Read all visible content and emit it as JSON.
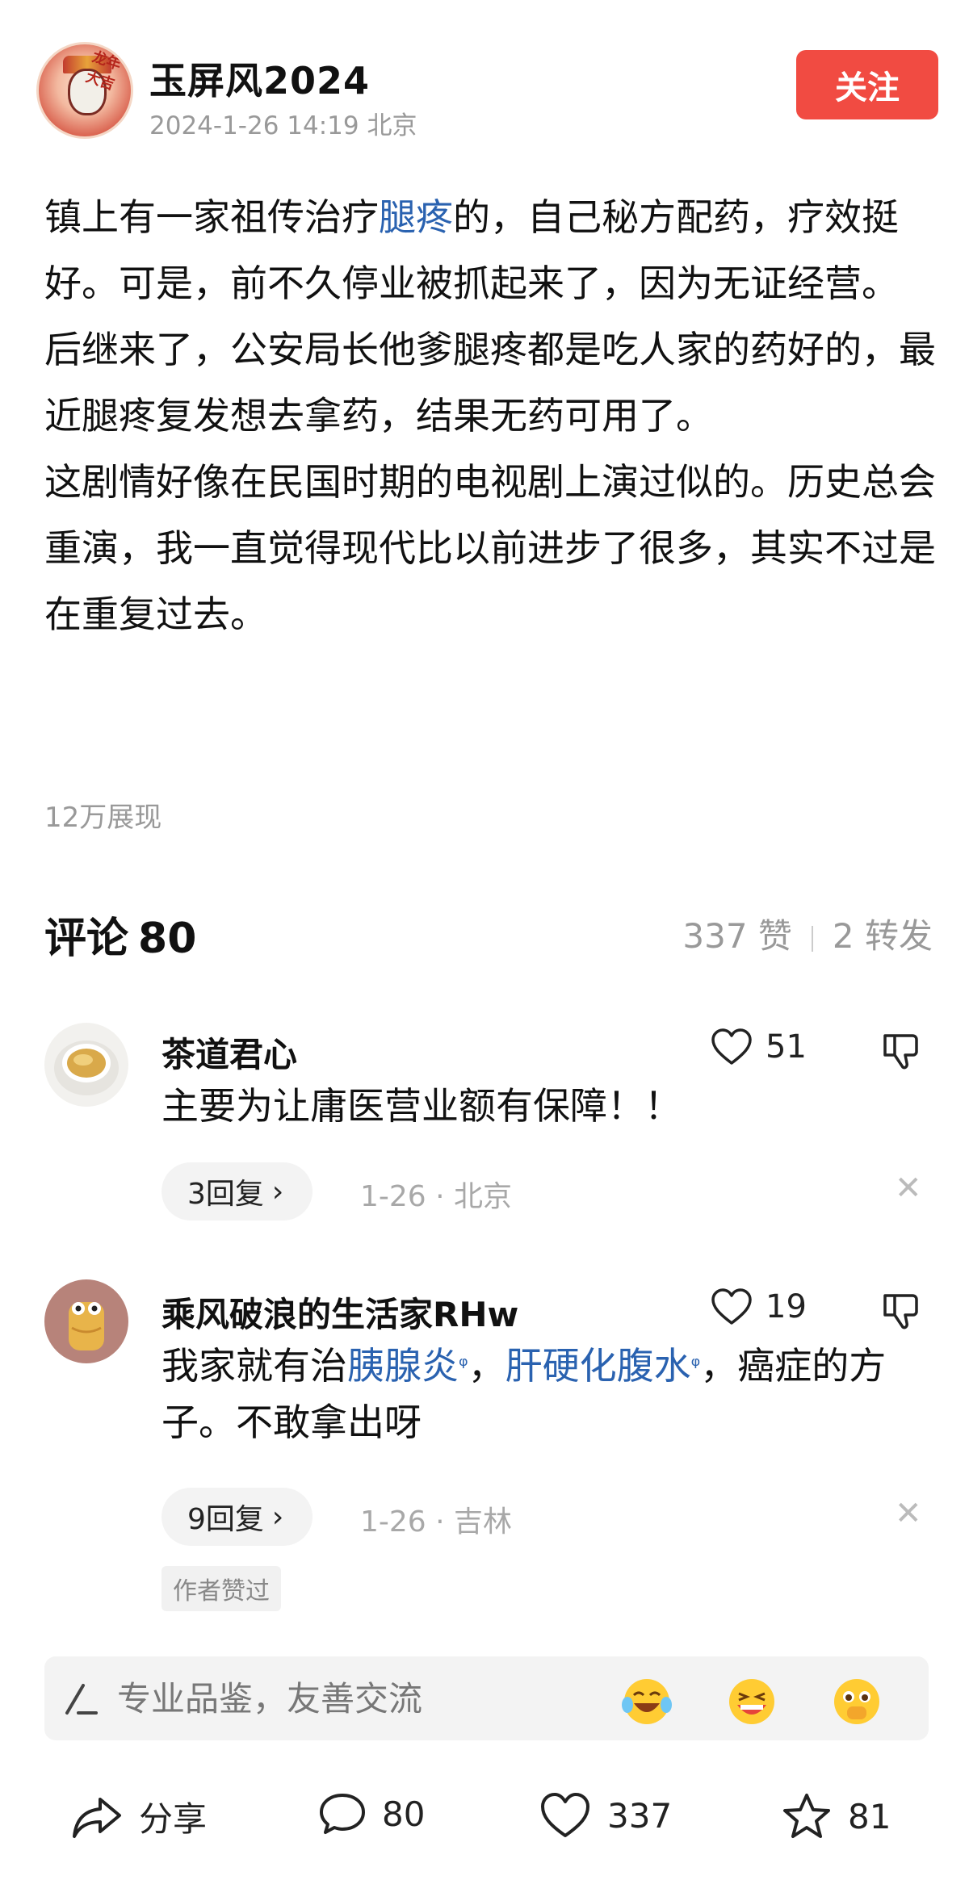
{
  "header": {
    "username": "玉屏风2024",
    "meta": "2024-1-26 14:19 北京",
    "follow_label": "关注",
    "avatar_text": "龙年大吉"
  },
  "post": {
    "para1_pre": "镇上有一家祖传治疗",
    "para1_link": "腿疼",
    "para1_post": "的，自己秘方配药，疗效挺好。可是，前不久停业被抓起来了，因为无证经营。",
    "para2": "后继来了，公安局长他爹腿疼都是吃人家的药好的，最近腿疼复发想去拿药，结果无药可用了。",
    "para3": "这剧情好像在民国时期的电视剧上演过似的。历史总会重演，我一直觉得现代比以前进步了很多，其实不过是在重复过去。",
    "views": "12万展现"
  },
  "comments_header": {
    "title": "评论",
    "count": "80",
    "likes": "337 赞",
    "reposts": "2 转发"
  },
  "comments": [
    {
      "name": "茶道君心",
      "text": "主要为让庸医营业额有保障！！",
      "likes": "51",
      "replies": "3回复",
      "meta": "1-26 · 北京"
    },
    {
      "name": "乘风破浪的生活家RHw",
      "text_pre": "我家就有治",
      "link1": "胰腺炎",
      "text_mid": "，",
      "link2": "肝硬化腹水",
      "text_post": "，癌症的方子。不敢拿出呀",
      "likes": "19",
      "replies": "9回复",
      "meta": "1-26 · 吉林",
      "badge": "作者赞过"
    }
  ],
  "input": {
    "placeholder": "专业品鉴，友善交流"
  },
  "bottom_bar": {
    "share": "分享",
    "comments": "80",
    "likes": "337",
    "favorites": "81"
  },
  "colors": {
    "accent_red": "#f14b42",
    "link_blue": "#2a62b0",
    "muted_text": "#999999"
  }
}
